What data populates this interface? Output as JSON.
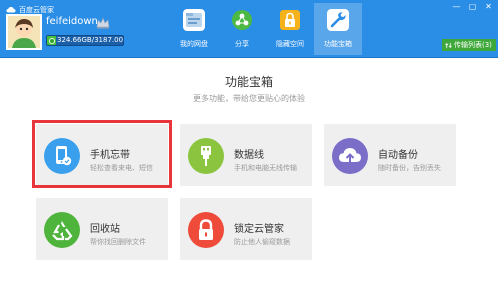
{
  "app": {
    "title": "百度云管家"
  },
  "window": {
    "controls": [
      "—",
      "▢",
      "✕"
    ]
  },
  "user": {
    "name": "feifeidown",
    "storage_text": "324.66GB/3187.00GB",
    "storage_fraction": 0.102
  },
  "nav": {
    "tabs": [
      {
        "label": "我的网盘",
        "icon": "folder-icon",
        "active": false
      },
      {
        "label": "分享",
        "icon": "share-icon",
        "active": false
      },
      {
        "label": "隐藏空间",
        "icon": "lock-icon",
        "active": false
      },
      {
        "label": "功能宝箱",
        "icon": "toolbox-icon",
        "active": true
      }
    ]
  },
  "transfer": {
    "label": "传输列表(3)"
  },
  "main": {
    "title": "功能宝箱",
    "subtitle": "更多功能，带给您更贴心的体验"
  },
  "tiles": [
    {
      "name": "手机忘带",
      "desc": "轻松查看来电、短信",
      "icon": "phone-forget-icon",
      "color": "#3aa0ee"
    },
    {
      "name": "数据线",
      "desc": "手机和电脑无线传输",
      "icon": "usb-cable-icon",
      "color": "#8bc53f"
    },
    {
      "name": "自动备份",
      "desc": "随时备份，告别丢失",
      "icon": "cloud-upload-icon",
      "color": "#7a6ec8"
    },
    {
      "name": "回收站",
      "desc": "帮你找回删除文件",
      "icon": "recycle-icon",
      "color": "#4fb43c"
    },
    {
      "name": "锁定云管家",
      "desc": "防止他人偷窥数据",
      "icon": "lock-icon",
      "color": "#ee4b3a"
    }
  ],
  "colors": {
    "topbar": "#2b8ee6",
    "highlight": "#e8343b",
    "tile_bg": "#efefef"
  }
}
